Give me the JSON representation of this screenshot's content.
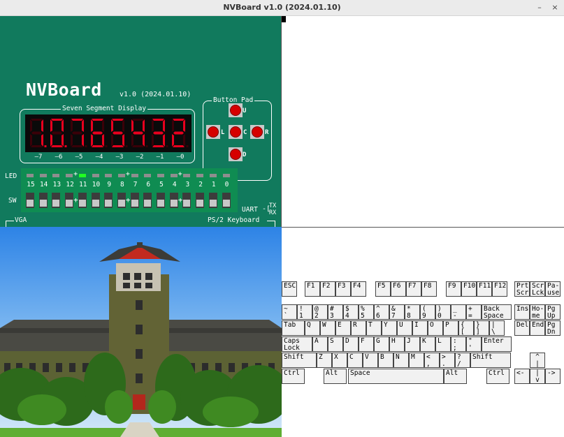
{
  "window": {
    "title": "NVBoard v1.0 (2024.01.10)",
    "minimize": "–",
    "close": "×"
  },
  "board": {
    "logo": "NVBoard",
    "version": "v1.0 (2024.01.10)",
    "seven_segment": {
      "label": "Seven Segment Display",
      "digits": [
        "1.",
        "0.",
        "7",
        "6",
        "5",
        "4",
        "3",
        "2"
      ],
      "indexes": [
        "7",
        "6",
        "5",
        "4",
        "3",
        "2",
        "1",
        "0"
      ],
      "segment_color": "#e8001e",
      "off_color": "#3a0008"
    },
    "button_pad": {
      "label": "Button Pad",
      "buttons": [
        "U",
        "L",
        "C",
        "R",
        "D"
      ],
      "button_color": "#d50000"
    },
    "led": {
      "label": "LED",
      "lit_index": 11,
      "lit_color": "#22ff22",
      "numbers": [
        "15",
        "14",
        "13",
        "12",
        "11",
        "10",
        "9",
        "8",
        "7",
        "6",
        "5",
        "4",
        "3",
        "2",
        "1",
        "0"
      ]
    },
    "sw": {
      "label": "SW"
    },
    "uart": {
      "label": "UART",
      "tx": "TX",
      "rx": "RX"
    },
    "vga": {
      "label": "VGA"
    },
    "ps2": {
      "label": "PS/2 Keyboard"
    },
    "board_color": "#117a5d"
  },
  "keyboard": {
    "rows": [
      [
        "ESC",
        "F1",
        "F2",
        "F3",
        "F4",
        "F5",
        "F6",
        "F7",
        "F8",
        "F9",
        "F10",
        "F11",
        "F12",
        "Prt|Scr",
        "Scr|Lck",
        "Pa-|use"
      ],
      [
        "~|`",
        "!|1",
        "@|2",
        "#|3",
        "$|4",
        "%|5",
        "^|6",
        "&|7",
        "*|8",
        "(|9",
        ")|0",
        "_|-",
        "+|=",
        "Back|Space",
        "Ins",
        "Ho-|me",
        "Pg|Up"
      ],
      [
        "Tab",
        "Q",
        "W",
        "E",
        "R",
        "T",
        "Y",
        "U",
        "I",
        "O",
        "P",
        "{|[",
        "}|]",
        "||\\",
        "Del",
        "End",
        "Pg|Dn"
      ],
      [
        "Caps|Lock",
        "A",
        "S",
        "D",
        "F",
        "G",
        "H",
        "J",
        "K",
        "L",
        ":|;",
        "\"|'",
        "Enter"
      ],
      [
        "Shift",
        "Z",
        "X",
        "C",
        "V",
        "B",
        "N",
        "M",
        "<|,",
        ">|.",
        "?|/",
        "Shift",
        "^||"
      ],
      [
        "Ctrl",
        "Alt",
        "Space",
        "Alt",
        "Ctrl",
        "<-",
        "||v",
        "->"
      ]
    ]
  }
}
